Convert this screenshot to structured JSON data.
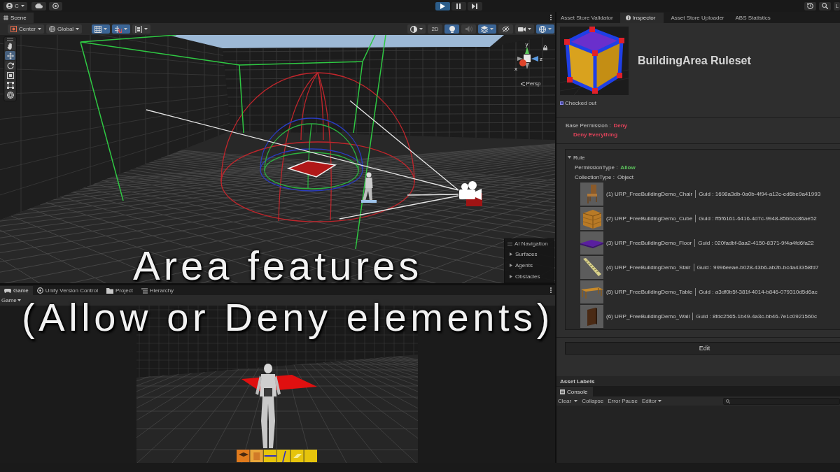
{
  "top_bar": {
    "account": {
      "label": "C"
    },
    "play_controls": [
      {
        "kind": "play",
        "on": true
      },
      {
        "kind": "pause",
        "on": false
      },
      {
        "kind": "step",
        "on": false
      }
    ],
    "layout": {
      "label": "L"
    }
  },
  "scene_panel": {
    "tab": {
      "label": "Scene"
    },
    "pivot": {
      "label": "Center"
    },
    "space": {
      "label": "Global"
    },
    "snap_tools": [
      {
        "kind": "grid",
        "on": true
      },
      {
        "kind": "snap",
        "on": true
      },
      {
        "kind": "align",
        "on": false
      }
    ],
    "view_options": [
      {
        "kind": "shading",
        "on": false
      },
      {
        "kind": "mode2d",
        "label": "2D",
        "on": false
      },
      {
        "kind": "lighting",
        "on": true
      },
      {
        "kind": "audio",
        "on": false
      },
      {
        "kind": "effects",
        "on": true
      },
      {
        "kind": "visibility",
        "on": false
      },
      {
        "kind": "camera",
        "on": false
      },
      {
        "kind": "gizmos",
        "on": true
      }
    ],
    "tools": [
      {
        "kind": "hand",
        "selected": false
      },
      {
        "kind": "move",
        "selected": true
      },
      {
        "kind": "rotate",
        "selected": false
      },
      {
        "kind": "scale",
        "selected": false
      },
      {
        "kind": "rect",
        "selected": false
      },
      {
        "kind": "transform",
        "selected": false
      }
    ],
    "gizmo": {
      "axes": [
        "y",
        "z",
        "x"
      ],
      "projection": "Persp"
    },
    "ai_navigation": {
      "title": "AI Navigation",
      "items": [
        {
          "label": "Surfaces",
          "expanded": false
        },
        {
          "label": "Agents",
          "expanded": false
        },
        {
          "label": "Obstacles",
          "expanded": false
        }
      ]
    }
  },
  "game_panel": {
    "tabs": [
      {
        "kind": "game",
        "label": "Game",
        "selected": true
      },
      {
        "kind": "version_control",
        "label": "Unity Version Control",
        "selected": false
      },
      {
        "kind": "project",
        "label": "Project",
        "selected": false
      },
      {
        "kind": "hierarchy",
        "label": "Hierarchy",
        "selected": false
      }
    ],
    "display": {
      "label": "Game"
    },
    "hotbar": [
      {
        "kind": "slab",
        "color": "#e07a1c"
      },
      {
        "kind": "crate",
        "color": "#e8a63a"
      },
      {
        "kind": "beam",
        "color": "#e6c40c"
      },
      {
        "kind": "post",
        "color": "#e6c40c"
      },
      {
        "kind": "panel",
        "color": "#e6c40c"
      },
      {
        "kind": "none",
        "color": "#e6c40c"
      }
    ]
  },
  "inspector_panel": {
    "tabs": [
      {
        "kind": "plain",
        "label": "Asset Store Validator",
        "selected": false
      },
      {
        "kind": "inspector",
        "label": "Inspector",
        "selected": true
      },
      {
        "kind": "plain",
        "label": "Asset Store Uploader",
        "selected": false
      },
      {
        "kind": "plain",
        "label": "ABS Statistics",
        "selected": false
      }
    ],
    "asset": {
      "title": "BuildingArea Ruleset",
      "status": "Checked out"
    },
    "base_permission": {
      "label": "Base Permission :",
      "value": "Deny",
      "kind": "deny",
      "note": "Deny Everything"
    },
    "rule": {
      "title": "Rule",
      "expanded": true,
      "fields": [
        {
          "label": "PermissionType :",
          "value": "Allow",
          "kind": "allow"
        },
        {
          "label": "CollectionType :",
          "value": "Object",
          "kind": "plain"
        }
      ],
      "items": [
        {
          "kind": "chair",
          "name": "(1) URP_FreeBuildingDemo_Chair",
          "guid": "Guid : 1698a3db-0a0b-4f94-a12c-ed6be9a41993"
        },
        {
          "kind": "crate",
          "name": "(2) URP_FreeBuildingDemo_Cube",
          "guid": "Guid : ff5f6161-6416-4d7c-9948-85bbcc86ae52"
        },
        {
          "kind": "slab",
          "name": "(3) URP_FreeBuildingDemo_Floor",
          "guid": "Guid : 020fadbf-8aa2-4150-8371-9f4a4fd6fa22"
        },
        {
          "kind": "stairs",
          "name": "(4) URP_FreeBuildingDemo_Stair",
          "guid": "Guid : 9996eeae-b028-43b6-ab2b-bc4a43358fd7"
        },
        {
          "kind": "table",
          "name": "(5) URP_FreeBuildingDemo_Table",
          "guid": "Guid : a3df0b5f-381f-4014-b846-079310d5d6ac"
        },
        {
          "kind": "panel",
          "name": "(6) URP_FreeBuildingDemo_Wall",
          "guid": "Guid : 8fdc2565-1b49-4a3c-bb46-7e1c0921560c"
        }
      ]
    },
    "edit_button": {
      "label": "Edit"
    },
    "asset_labels": {
      "label": "Asset Labels"
    }
  },
  "console": {
    "tab": {
      "label": "Console"
    },
    "clear": {
      "label": "Clear"
    },
    "toggles": [
      {
        "label": "Collapse"
      },
      {
        "label": "Error Pause"
      }
    ],
    "editor": {
      "label": "Editor"
    }
  },
  "caption": {
    "lines": [
      "Area features",
      "(Allow or Deny elements)"
    ]
  }
}
